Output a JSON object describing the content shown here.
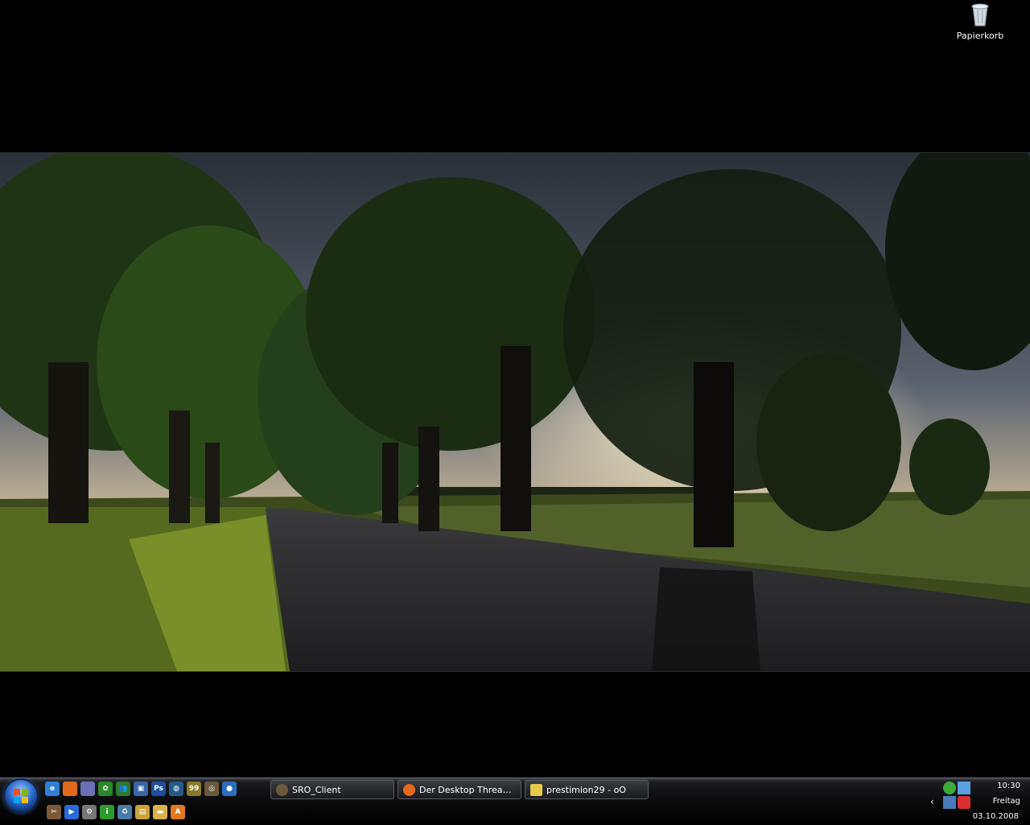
{
  "desktop": {
    "icons": [
      {
        "label": "Papierkorb",
        "icon": "recycle-bin-icon"
      }
    ]
  },
  "taskbar": {
    "quick_launch_row1": [
      {
        "icon": "ie-icon",
        "glyph": "e",
        "color": "#2f7fd8"
      },
      {
        "icon": "firefox-icon",
        "glyph": "",
        "color": "#e06a1b"
      },
      {
        "icon": "headset-icon",
        "glyph": "",
        "color": "#6b6fb8"
      },
      {
        "icon": "icq-flower-icon",
        "glyph": "✿",
        "color": "#2a8a2a"
      },
      {
        "icon": "messenger-icon",
        "glyph": "👥",
        "color": "#2d7c2d"
      },
      {
        "icon": "computer-icon",
        "glyph": "▣",
        "color": "#3a66a8"
      },
      {
        "icon": "photoshop-icon",
        "glyph": "Ps",
        "color": "#1e4e9e"
      },
      {
        "icon": "network-globe-icon",
        "glyph": "◍",
        "color": "#235a8a"
      },
      {
        "icon": "cd-99-icon",
        "glyph": "99",
        "color": "#8a7a2a"
      },
      {
        "icon": "game-client-icon",
        "glyph": "◎",
        "color": "#6a5a3a"
      },
      {
        "icon": "earth-globe-icon",
        "glyph": "●",
        "color": "#2c6fbf"
      }
    ],
    "quick_launch_row2": [
      {
        "icon": "tools-icon",
        "glyph": "✂",
        "color": "#7a5a3a"
      },
      {
        "icon": "media-player-icon",
        "glyph": "▶",
        "color": "#2a6ad8"
      },
      {
        "icon": "settings-gear-icon",
        "glyph": "⚙",
        "color": "#777777"
      },
      {
        "icon": "info-icon",
        "glyph": "i",
        "color": "#2e9a2e"
      },
      {
        "icon": "recycle-small-icon",
        "glyph": "♻",
        "color": "#4a7aa8"
      },
      {
        "icon": "folder-files-icon",
        "glyph": "▤",
        "color": "#c9a33a"
      },
      {
        "icon": "folder-icon",
        "glyph": "▬",
        "color": "#d8b24a"
      },
      {
        "icon": "avast-icon",
        "glyph": "A",
        "color": "#e07a20"
      }
    ],
    "tasks": [
      {
        "label": "SRO_Client",
        "icon": "game-client-icon",
        "color": "#6a5a3a"
      },
      {
        "label": "Der Desktop Thread - ...",
        "icon": "firefox-icon",
        "color": "#e06a1b"
      },
      {
        "label": "prestimion29 - oO",
        "icon": "chat-note-icon",
        "color": "#e6c84a"
      }
    ],
    "tray": {
      "time": "10:30",
      "weekday": "Freitag",
      "date": "03.10.2008",
      "icons": [
        {
          "icon": "icq-tray-icon",
          "color": "#3cab3c"
        },
        {
          "icon": "network-tray-icon",
          "color": "#5aa0e0"
        },
        {
          "icon": "connection-tray-icon",
          "color": "#4a7ab8"
        },
        {
          "icon": "antivirus-tray-icon",
          "color": "#d83030"
        }
      ]
    }
  }
}
